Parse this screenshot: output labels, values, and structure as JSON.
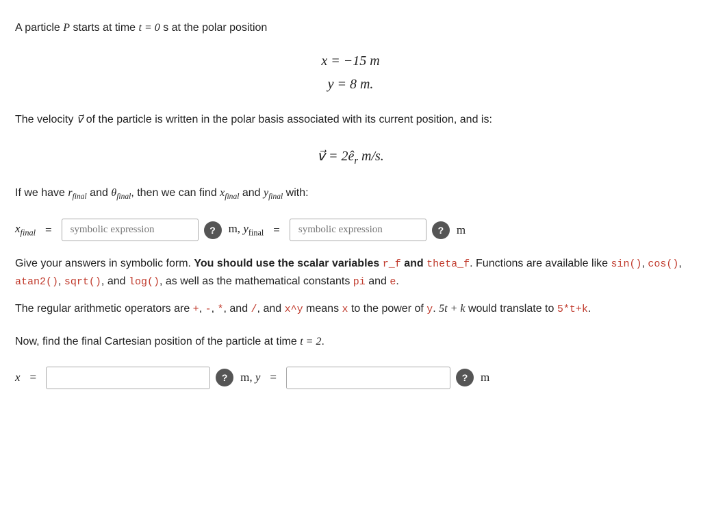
{
  "intro": {
    "line1": "A particle ",
    "P": "P",
    "line1b": " starts at time ",
    "t0": "t = 0",
    "line1c": " s at the polar position"
  },
  "position_equations": {
    "x_eq": "x = −15 m",
    "y_eq": "y = 8 m."
  },
  "velocity_intro": "The velocity ",
  "velocity_var": "v",
  "velocity_text": " of the particle is written in the polar basis associated with its current position, and is:",
  "velocity_eq": {
    "lhs": "v⃗ = 2ê",
    "rhs_sub": "r",
    "unit": "m/s."
  },
  "rfinal_text": {
    "part1": "If we have ",
    "r": "r",
    "sub_r": "final",
    "part2": " and ",
    "theta": "θ",
    "sub_theta": "final",
    "part3": ", then we can find ",
    "x": "x",
    "sub_x": "final",
    "part4": " and ",
    "y": "y",
    "sub_y": "final",
    "part5": " with:"
  },
  "input_row1": {
    "x_label": "x",
    "x_sub": "final",
    "eq": "=",
    "placeholder1": "symbolic expression",
    "help1": "?",
    "unit1": "m,",
    "y_label": "y",
    "y_sub": "final",
    "eq2": "=",
    "placeholder2": "symbolic expression",
    "help2": "?",
    "unit2": "m"
  },
  "instructions": {
    "line1_pre": "Give your answers in symbolic form. ",
    "line1_bold": "You should use the scalar variables ",
    "r_f": "r_f",
    "and_text": " and ",
    "theta_f": "theta_f",
    "line1_post": ". Functions are",
    "line2_pre": "available like ",
    "sin": "sin()",
    "comma1": ", ",
    "cos": "cos()",
    "comma2": ", ",
    "atan2": "atan2()",
    "comma3": ", ",
    "sqrt": "sqrt()",
    "line2_mid": ", and ",
    "log": "log()",
    "line2_post": ", as well as the mathematical constants ",
    "pi": "pi",
    "line2_end_pre": " and ",
    "e": "e",
    "line2_end": ".",
    "line3_pre": "The regular arithmetic operators are ",
    "plus": "+",
    "comma4": ", ",
    "minus": "-",
    "comma5": ", ",
    "mult": "*",
    "line3_mid": ", and ",
    "div": "/",
    "line3_post": ", and ",
    "xhat": "x^y",
    "line3_post2": " means ",
    "x_var": "x",
    "line3_post3": " to the power of ",
    "y_var": "y",
    "line3_end": ". 5t + k would",
    "line4_pre": "translate to ",
    "code": "5*t+k",
    "line4_end": "."
  },
  "final_section": {
    "text": "Now, find the final Cartesian position of the particle at time ",
    "t_eq": "t = 2",
    "end": "."
  },
  "input_row2": {
    "x_label": "x",
    "eq": "=",
    "placeholder1": "",
    "help1": "?",
    "unit1": "m,",
    "y_label": "y",
    "eq2": "=",
    "placeholder2": "",
    "help2": "?",
    "unit2": "m"
  }
}
